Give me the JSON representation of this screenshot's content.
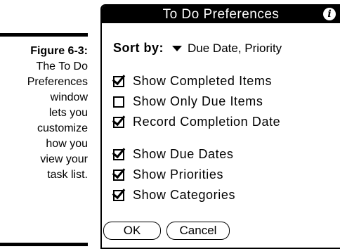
{
  "caption": {
    "figure_label": "Figure 6-3:",
    "text": "The To Do\nPreferences\nwindow\nlets you\ncustomize\nhow you\nview your\ntask list."
  },
  "dialog": {
    "title": "To Do Preferences",
    "info_icon": "info-icon",
    "sort": {
      "label": "Sort by:",
      "value": "Due Date, Priority"
    },
    "options": [
      {
        "label": "Show Completed Items",
        "checked": true
      },
      {
        "label": "Show Only Due Items",
        "checked": false
      },
      {
        "label": "Record Completion Date",
        "checked": true
      },
      {
        "label": "Show Due Dates",
        "checked": true
      },
      {
        "label": "Show Priorities",
        "checked": true
      },
      {
        "label": "Show Categories",
        "checked": true
      }
    ],
    "buttons": {
      "ok": "OK",
      "cancel": "Cancel"
    }
  }
}
